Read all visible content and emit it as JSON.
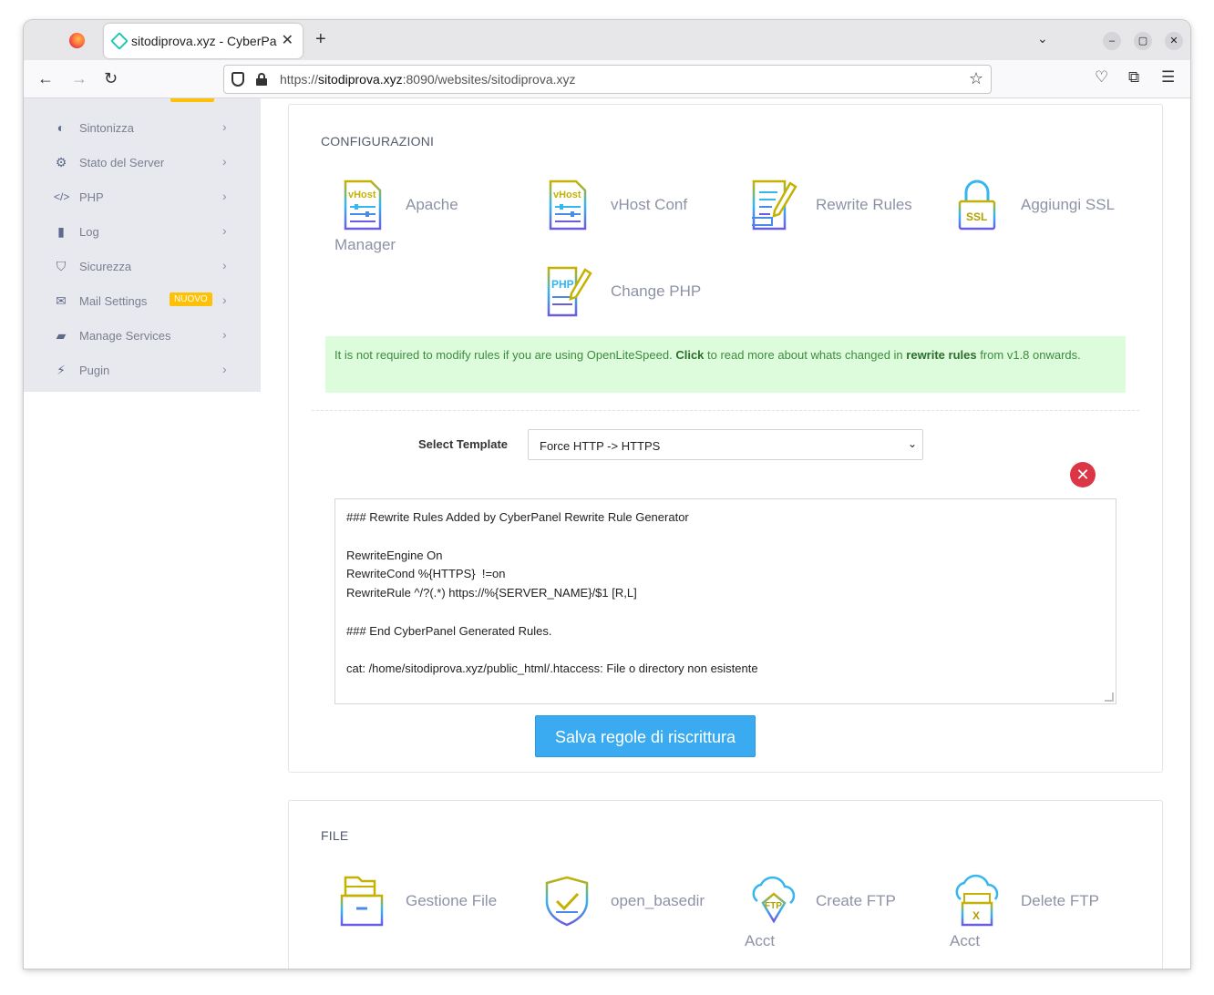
{
  "browser": {
    "tab_title": "sitodiprova.xyz - CyberPa",
    "url_host": "sitodiprova.xyz",
    "url_prefix": "https://",
    "url_rest": ":8090/websites/sitodiprova.xyz"
  },
  "sidebar": {
    "items": [
      {
        "label": "Sintonizza",
        "icon": "half-circle-icon"
      },
      {
        "label": "Stato del Server",
        "icon": "gear-icon"
      },
      {
        "label": "PHP",
        "icon": "code-icon"
      },
      {
        "label": "Log",
        "icon": "file-icon"
      },
      {
        "label": "Sicurezza",
        "icon": "shield-icon"
      },
      {
        "label": "Mail Settings",
        "icon": "envelope-icon",
        "badge": "NUOVO"
      },
      {
        "label": "Manage Services",
        "icon": "folder-open-icon"
      },
      {
        "label": "Pugin",
        "icon": "plug-icon"
      }
    ]
  },
  "config": {
    "title": "CONFIGURAZIONI",
    "tools": [
      {
        "label1": "Apache",
        "label2": "Manager",
        "icon": "vhost-doc-icon"
      },
      {
        "label1": "vHost Conf",
        "label2": "",
        "icon": "vhost-doc-icon"
      },
      {
        "label1": "Rewrite Rules",
        "label2": "",
        "icon": "document-pen-icon"
      },
      {
        "label1": "Aggiungi SSL",
        "label2": "",
        "icon": "ssl-lock-icon"
      },
      {
        "label1": "Change PHP",
        "label2": "",
        "icon": "php-doc-icon"
      }
    ],
    "alert": {
      "part1": "It is not required to modify rules if you are using OpenLiteSpeed. ",
      "click": "Click",
      "part2": " to read more about whats changed in ",
      "link": "rewrite rules",
      "part3": " from v1.8 onwards."
    },
    "template_label": "Select Template",
    "template_value": "Force HTTP -> HTTPS",
    "editor_lines": [
      "### Rewrite Rules Added by CyberPanel Rewrite Rule Generator",
      "",
      "RewriteEngine On",
      "RewriteCond %{HTTPS}  !=on",
      "RewriteRule ^/?(.*) https://%{SERVER_NAME}/$1 [R,L]",
      "",
      "### End CyberPanel Generated Rules.",
      "",
      "cat: /home/sitodiprova.xyz/public_html/.htaccess: File o directory non esistente"
    ],
    "save_label": "Salva regole di riscrittura"
  },
  "file": {
    "title": "FILE",
    "tools": [
      {
        "label1": "Gestione File",
        "label2": "",
        "icon": "file-cabinet-icon"
      },
      {
        "label1": "open_basedir",
        "label2": "",
        "icon": "shield-check-icon"
      },
      {
        "label1": "Create FTP",
        "label2": "Acct",
        "icon": "ftp-cloud-icon"
      },
      {
        "label1": "Delete FTP",
        "label2": "Acct",
        "icon": "ftp-delete-icon"
      }
    ]
  },
  "colors": {
    "accent": "#3aabf0",
    "icon_gradient_start": "#c5b200",
    "icon_gradient_end": "#3b7ce8",
    "alert_bg": "#dcfcdc",
    "danger": "#dc3545",
    "badge": "#ffc107"
  }
}
